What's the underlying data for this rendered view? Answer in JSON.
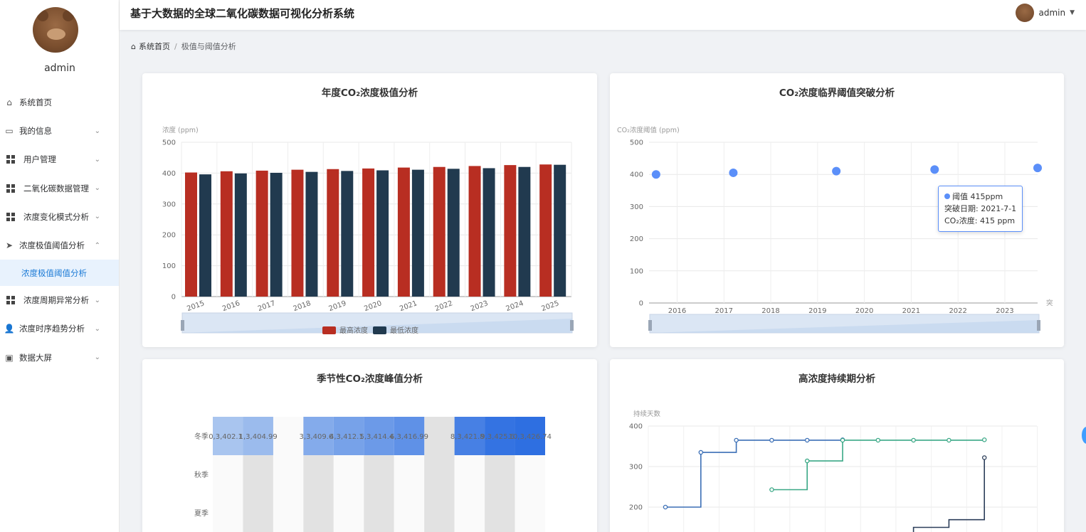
{
  "app": {
    "title": "基于大数据的全球二氧化碳数据可视化分析系统",
    "username": "admin"
  },
  "sidebar": {
    "username": "admin",
    "items": [
      {
        "label": "系统首页",
        "icon": "home-icon"
      },
      {
        "label": "我的信息",
        "icon": "card-icon",
        "chevron": "⌄"
      },
      {
        "label": "用户管理",
        "icon": "grid-icon",
        "chevron": "⌄"
      },
      {
        "label": "二氧化碳数据管理",
        "icon": "apps-icon",
        "chevron": "⌄"
      },
      {
        "label": "浓度变化模式分析",
        "icon": "apps-icon",
        "chevron": "⌄"
      },
      {
        "label": "浓度极值阈值分析",
        "icon": "send-icon",
        "chevron": "⌃"
      },
      {
        "label": "浓度极值阈值分析",
        "icon": "",
        "sub": true
      },
      {
        "label": "浓度周期异常分析",
        "icon": "apps-icon",
        "chevron": "⌄"
      },
      {
        "label": "浓度时序趋势分析",
        "icon": "user-icon",
        "chevron": "⌄"
      },
      {
        "label": "数据大屏",
        "icon": "chart-icon",
        "chevron": "⌄"
      }
    ]
  },
  "breadcrumb": {
    "home": "系统首页",
    "separator": "/",
    "current": "极值与阈值分析"
  },
  "charts": {
    "c1_title": "年度CO₂浓度极值分析",
    "c2_title": "CO₂浓度临界阈值突破分析",
    "c3_title": "季节性CO₂浓度峰值分析",
    "c4_title": "高浓度持续期分析"
  },
  "tooltip": {
    "line1": "阈值 415ppm",
    "line2": "突破日期: 2021-7-1",
    "line3": "CO₂浓度: 415 ppm"
  },
  "chart_data": [
    {
      "type": "bar",
      "title": "年度CO₂浓度极值分析",
      "ylabel": "浓度 (ppm)",
      "ylim": [
        0,
        500
      ],
      "yticks": [
        0,
        100,
        200,
        300,
        400,
        500
      ],
      "categories": [
        "2015",
        "2016",
        "2017",
        "2018",
        "2019",
        "2020",
        "2021",
        "2022",
        "2023",
        "2024",
        "2025"
      ],
      "series": [
        {
          "name": "最高浓度",
          "color": "#b82e22",
          "values": [
            402,
            406,
            408,
            411,
            413,
            415,
            418,
            420,
            423,
            426,
            428
          ]
        },
        {
          "name": "最低浓度",
          "color": "#213a4f",
          "values": [
            396,
            399,
            401,
            404,
            407,
            409,
            411,
            414,
            416,
            420,
            427
          ]
        }
      ],
      "legend": "bottom",
      "datazoom": true
    },
    {
      "type": "scatter",
      "title": "CO₂浓度临界阈值突破分析",
      "ylabel": "CO₂浓度阈值 (ppm)",
      "xlabel": "突",
      "ylim": [
        0,
        500
      ],
      "yticks": [
        0,
        100,
        200,
        300,
        400,
        500
      ],
      "xticks": [
        "2016",
        "2017",
        "2018",
        "2019",
        "2020",
        "2021",
        "2022",
        "2023"
      ],
      "x": [
        2015.55,
        2017.2,
        2019.4,
        2021.5,
        2023.7
      ],
      "y": [
        400,
        405,
        410,
        415,
        420
      ],
      "color": "#5b8ff9",
      "datazoom": true
    },
    {
      "type": "heatmap",
      "title": "季节性CO₂浓度峰值分析",
      "rows": [
        "冬季",
        "秋季",
        "夏季"
      ],
      "cells": [
        {
          "row": "冬季",
          "col": 0,
          "label": "0,3,402.17",
          "value": 402.17
        },
        {
          "row": "冬季",
          "col": 1,
          "label": "1,3,404.99",
          "value": 404.99
        },
        {
          "row": "冬季",
          "col": 3,
          "label": "3,3,409.64",
          "value": 409.64
        },
        {
          "row": "冬季",
          "col": 4,
          "label": "4,3,412.15",
          "value": 412.15
        },
        {
          "row": "冬季",
          "col": 5,
          "label": "5,3,414.45",
          "value": 414.45
        },
        {
          "row": "冬季",
          "col": 6,
          "label": "6,3,416.99",
          "value": 416.99
        },
        {
          "row": "冬季",
          "col": 8,
          "label": "8,3,421.89",
          "value": 421.89
        },
        {
          "row": "冬季",
          "col": 9,
          "label": "9,3,425.68",
          "value": 425.68
        },
        {
          "row": "冬季",
          "col": 10,
          "label": "10,3,426.74",
          "value": 426.74
        }
      ]
    },
    {
      "type": "line",
      "title": "高浓度持续期分析",
      "ylabel": "持续天数",
      "yticks": [
        200,
        300,
        400
      ],
      "series": [
        {
          "color": "#3b6fb6",
          "x": [
            0,
            1,
            2,
            3,
            4,
            5
          ],
          "y": [
            200,
            335,
            365,
            365,
            365,
            366
          ]
        },
        {
          "color": "#3aa886",
          "x": [
            3,
            4,
            5,
            6,
            7,
            8,
            9
          ],
          "y": [
            243,
            314,
            365,
            365,
            365,
            365,
            366
          ]
        },
        {
          "color": "#2c3e5a",
          "x": [
            7,
            8,
            9
          ],
          "y": [
            150,
            169,
            322
          ]
        }
      ]
    }
  ]
}
